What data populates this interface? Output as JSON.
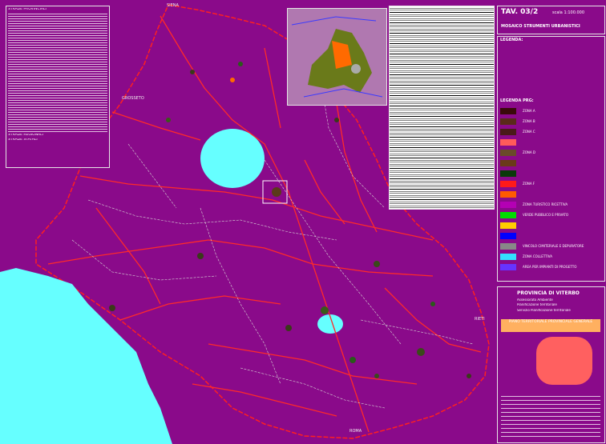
{
  "title_block": {
    "table": "TAV. 03/2",
    "scale": "scala 1:100.000",
    "subtitle": "MOSAICO STRUMENTI URBANISTICI"
  },
  "legend": {
    "heading": "LEGENDA:",
    "prg_heading": "LEGENDA PRG:",
    "prg_items": [
      {
        "label": "ZONA A",
        "color": "#3a0a0a"
      },
      {
        "label": "ZONA B",
        "color": "#5a2a1a"
      },
      {
        "label": "ZONA C",
        "color": "#4a1a1a"
      },
      {
        "label": "",
        "color": "#ff5a5a"
      },
      {
        "label": "ZONA D",
        "color": "#6a4a2a"
      },
      {
        "label": "",
        "color": "#6a3a1a"
      },
      {
        "label": "",
        "color": "#0a3a0a"
      },
      {
        "label": "ZONA F",
        "color": "#ff1a1a"
      },
      {
        "label": "",
        "color": "#ff5a00"
      },
      {
        "label": "ZONA TURISTICO RICETTIVA",
        "color": "#b400b4"
      },
      {
        "label": "VERDE PUBBLICO E PRIVATO",
        "color": "#00dd00"
      },
      {
        "label": "",
        "color": "#ffcc00"
      },
      {
        "label": "",
        "color": "#0000ff"
      },
      {
        "label": "VINCOLO CIMITERIALE E DEPURATORE",
        "color": "#888888"
      },
      {
        "label": "ZONA COLLETTIVA",
        "color": "#33e0ff"
      },
      {
        "label": "AREA PER IMPIANTI DI PROGETTO",
        "color": "#6633ff"
      }
    ]
  },
  "provincia": {
    "name": "PROVINCIA DI VITERBO",
    "line1": "Assessorato Ambiente",
    "line2": "Pianificazione territoriale",
    "line3": "Servizio Pianificazione territoriale",
    "plan": "PIANO TERRITORIALE PROVINCIALE GENERALE"
  },
  "strade": {
    "provinciali": "STRADE PROVINCIALI",
    "regionali": "STRADE REGIONALI",
    "statali": "STRADE STATALI"
  },
  "map_labels": {
    "siena": "SIENA",
    "grosseto": "GROSSETO",
    "rieti": "RIETI",
    "roma": "ROMA"
  },
  "colors": {
    "background": "#8a0a8a",
    "sea": "#66ffff",
    "roads": "#ff2a2a",
    "local_roads": "#d0d0d0"
  }
}
